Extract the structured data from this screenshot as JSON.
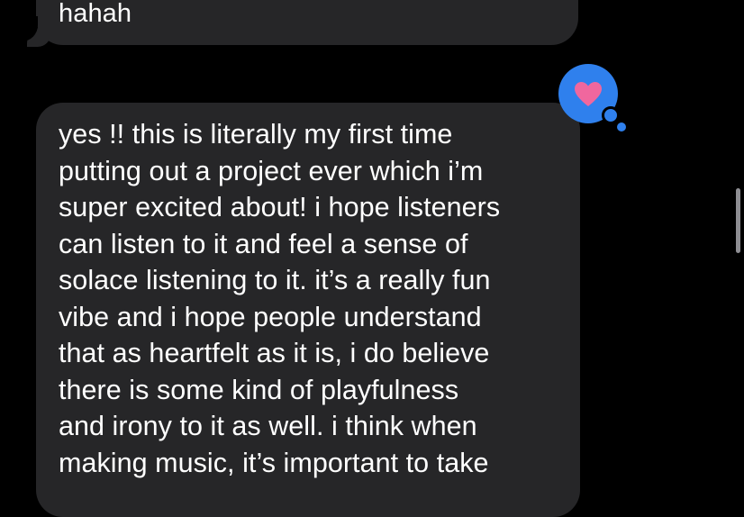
{
  "messages": [
    {
      "sender": "other",
      "text": "hahah"
    },
    {
      "sender": "other",
      "text": "yes !! this is literally my first time\nputting out a project ever which i’m\nsuper excited about! i hope listeners\ncan listen to it and feel a sense of\nsolace listening to it. it’s a really fun\nvibe and i hope people understand\nthat as heartfelt as it is, i do believe\nthere is some kind of playfulness\nand irony to it as well. i think when\nmaking music, it’s important to take",
      "reaction": "heart-icon"
    }
  ],
  "colors": {
    "background": "#000000",
    "bubble": "#262628",
    "text": "#ffffff",
    "tapback": "#2f80ed",
    "heart": "#f0679e",
    "scrollbar": "#8e8e93"
  }
}
